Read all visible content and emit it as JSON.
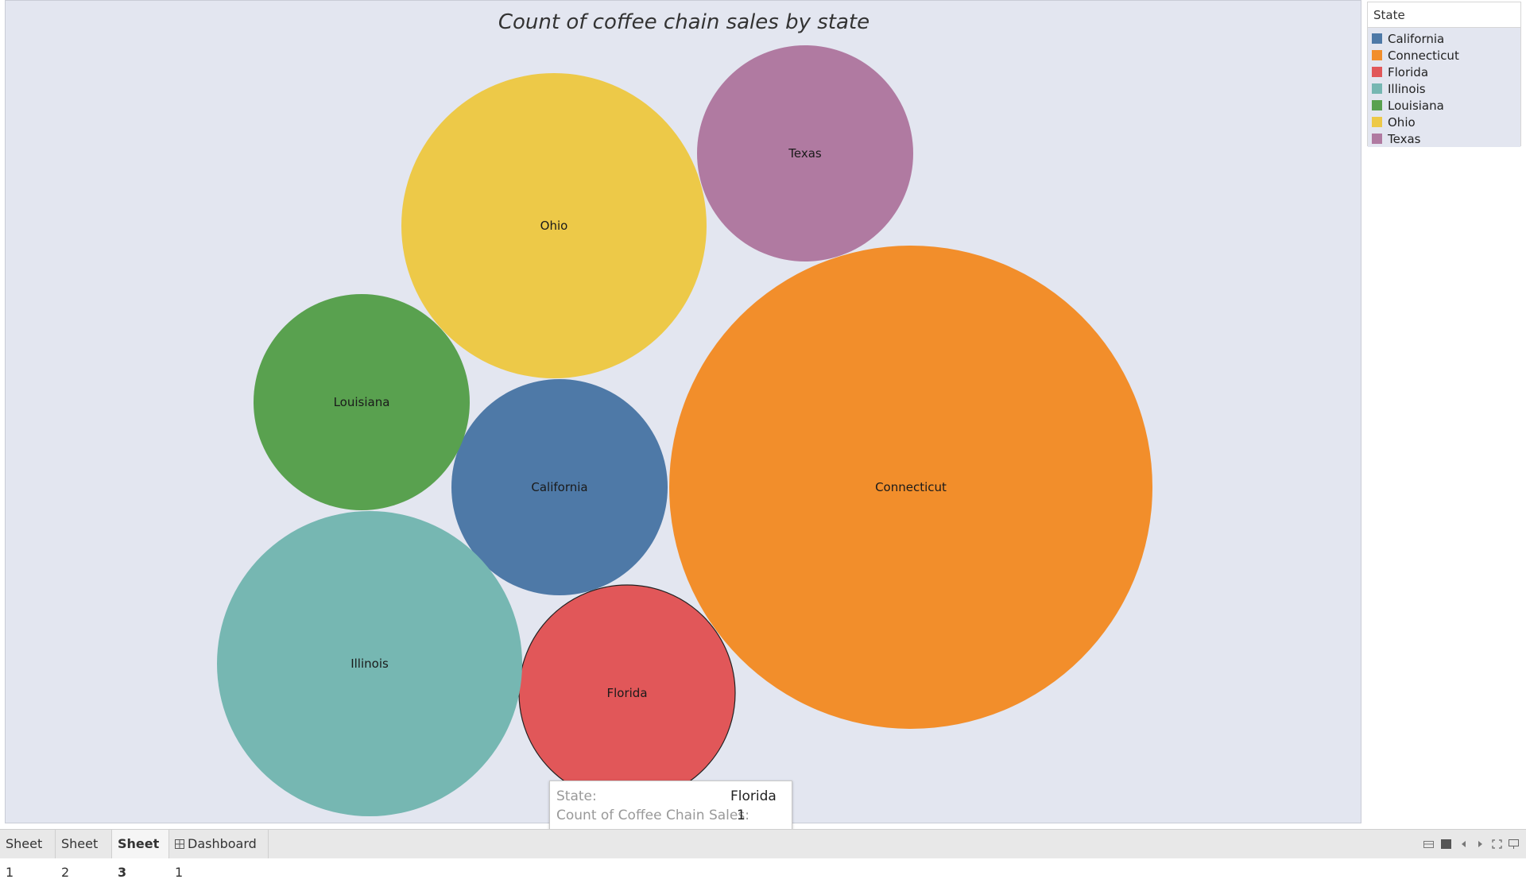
{
  "chart_data": {
    "type": "packed-bubble",
    "title": "Count of coffee chain sales by state",
    "legend_title": "State",
    "legend_position": "top-right",
    "series": [
      {
        "name": "California",
        "value": 1,
        "color": "#4e79a7"
      },
      {
        "name": "Connecticut",
        "value": 5,
        "color": "#f28e2b"
      },
      {
        "name": "Florida",
        "value": 1,
        "color": "#e15759"
      },
      {
        "name": "Illinois",
        "value": 2,
        "color": "#76b7b2"
      },
      {
        "name": "Louisiana",
        "value": 1,
        "color": "#59a14f"
      },
      {
        "name": "Ohio",
        "value": 2,
        "color": "#edc948"
      },
      {
        "name": "Texas",
        "value": 1,
        "color": "#b07aa1"
      }
    ],
    "selected": "Florida"
  },
  "tooltip": {
    "state_label": "State:",
    "state_value": "Florida",
    "count_label": "Count of Coffee Chain Sales:",
    "count_value": "1"
  },
  "tabs": [
    {
      "label": "Sheet 1",
      "active": false
    },
    {
      "label": "Sheet 2",
      "active": false
    },
    {
      "label": "Sheet 3",
      "active": true
    },
    {
      "label": "Dashboard 1",
      "active": false,
      "icon": "dashboard-grid-icon"
    }
  ],
  "controls": [
    "view-cards-icon",
    "presentation-icon",
    "prev-sheet-icon",
    "next-sheet-icon",
    "fullscreen-icon",
    "present-mode-icon"
  ]
}
